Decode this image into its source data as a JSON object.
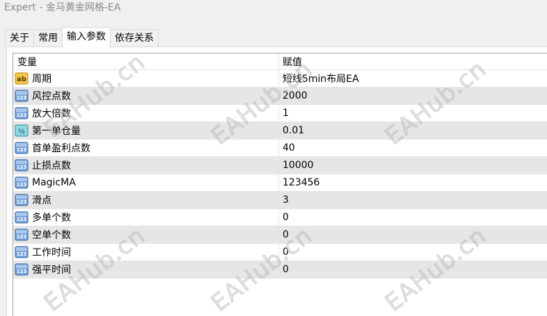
{
  "window": {
    "title": "Expert - 金马黄金网格-EA"
  },
  "tabs": [
    {
      "label": "关于",
      "active": false
    },
    {
      "label": "常用",
      "active": false
    },
    {
      "label": "输入参数",
      "active": true
    },
    {
      "label": "依存关系",
      "active": false
    }
  ],
  "table": {
    "headers": {
      "variable": "变量",
      "value": "赋值"
    },
    "rows": [
      {
        "icon": "string-ab-icon",
        "name": "周期",
        "value": "短线5min布局EA"
      },
      {
        "icon": "integer-123-icon",
        "name": "风控点数",
        "value": "2000"
      },
      {
        "icon": "integer-123-icon",
        "name": "放大倍数",
        "value": "1"
      },
      {
        "icon": "double-half-icon",
        "name": "第一单仓量",
        "value": "0.01"
      },
      {
        "icon": "integer-123-icon",
        "name": "首单盈利点数",
        "value": "40"
      },
      {
        "icon": "integer-123-icon",
        "name": "止损点数",
        "value": "10000"
      },
      {
        "icon": "integer-123-icon",
        "name": "MagicMA",
        "value": "123456"
      },
      {
        "icon": "integer-123-icon",
        "name": "滑点",
        "value": "3"
      },
      {
        "icon": "integer-123-icon",
        "name": "多单个数",
        "value": "0"
      },
      {
        "icon": "integer-123-icon",
        "name": "空单个数",
        "value": "0"
      },
      {
        "icon": "integer-123-icon",
        "name": "工作时间",
        "value": "0"
      },
      {
        "icon": "integer-123-icon",
        "name": "强平时间",
        "value": "0"
      }
    ]
  },
  "watermark": {
    "text": "EAHub.cn"
  },
  "colors": {
    "row_alt": "#e6e6e6",
    "int_icon": "#4a7fc0",
    "string_icon": "#d9a520",
    "double_icon": "#5bb8c8"
  }
}
